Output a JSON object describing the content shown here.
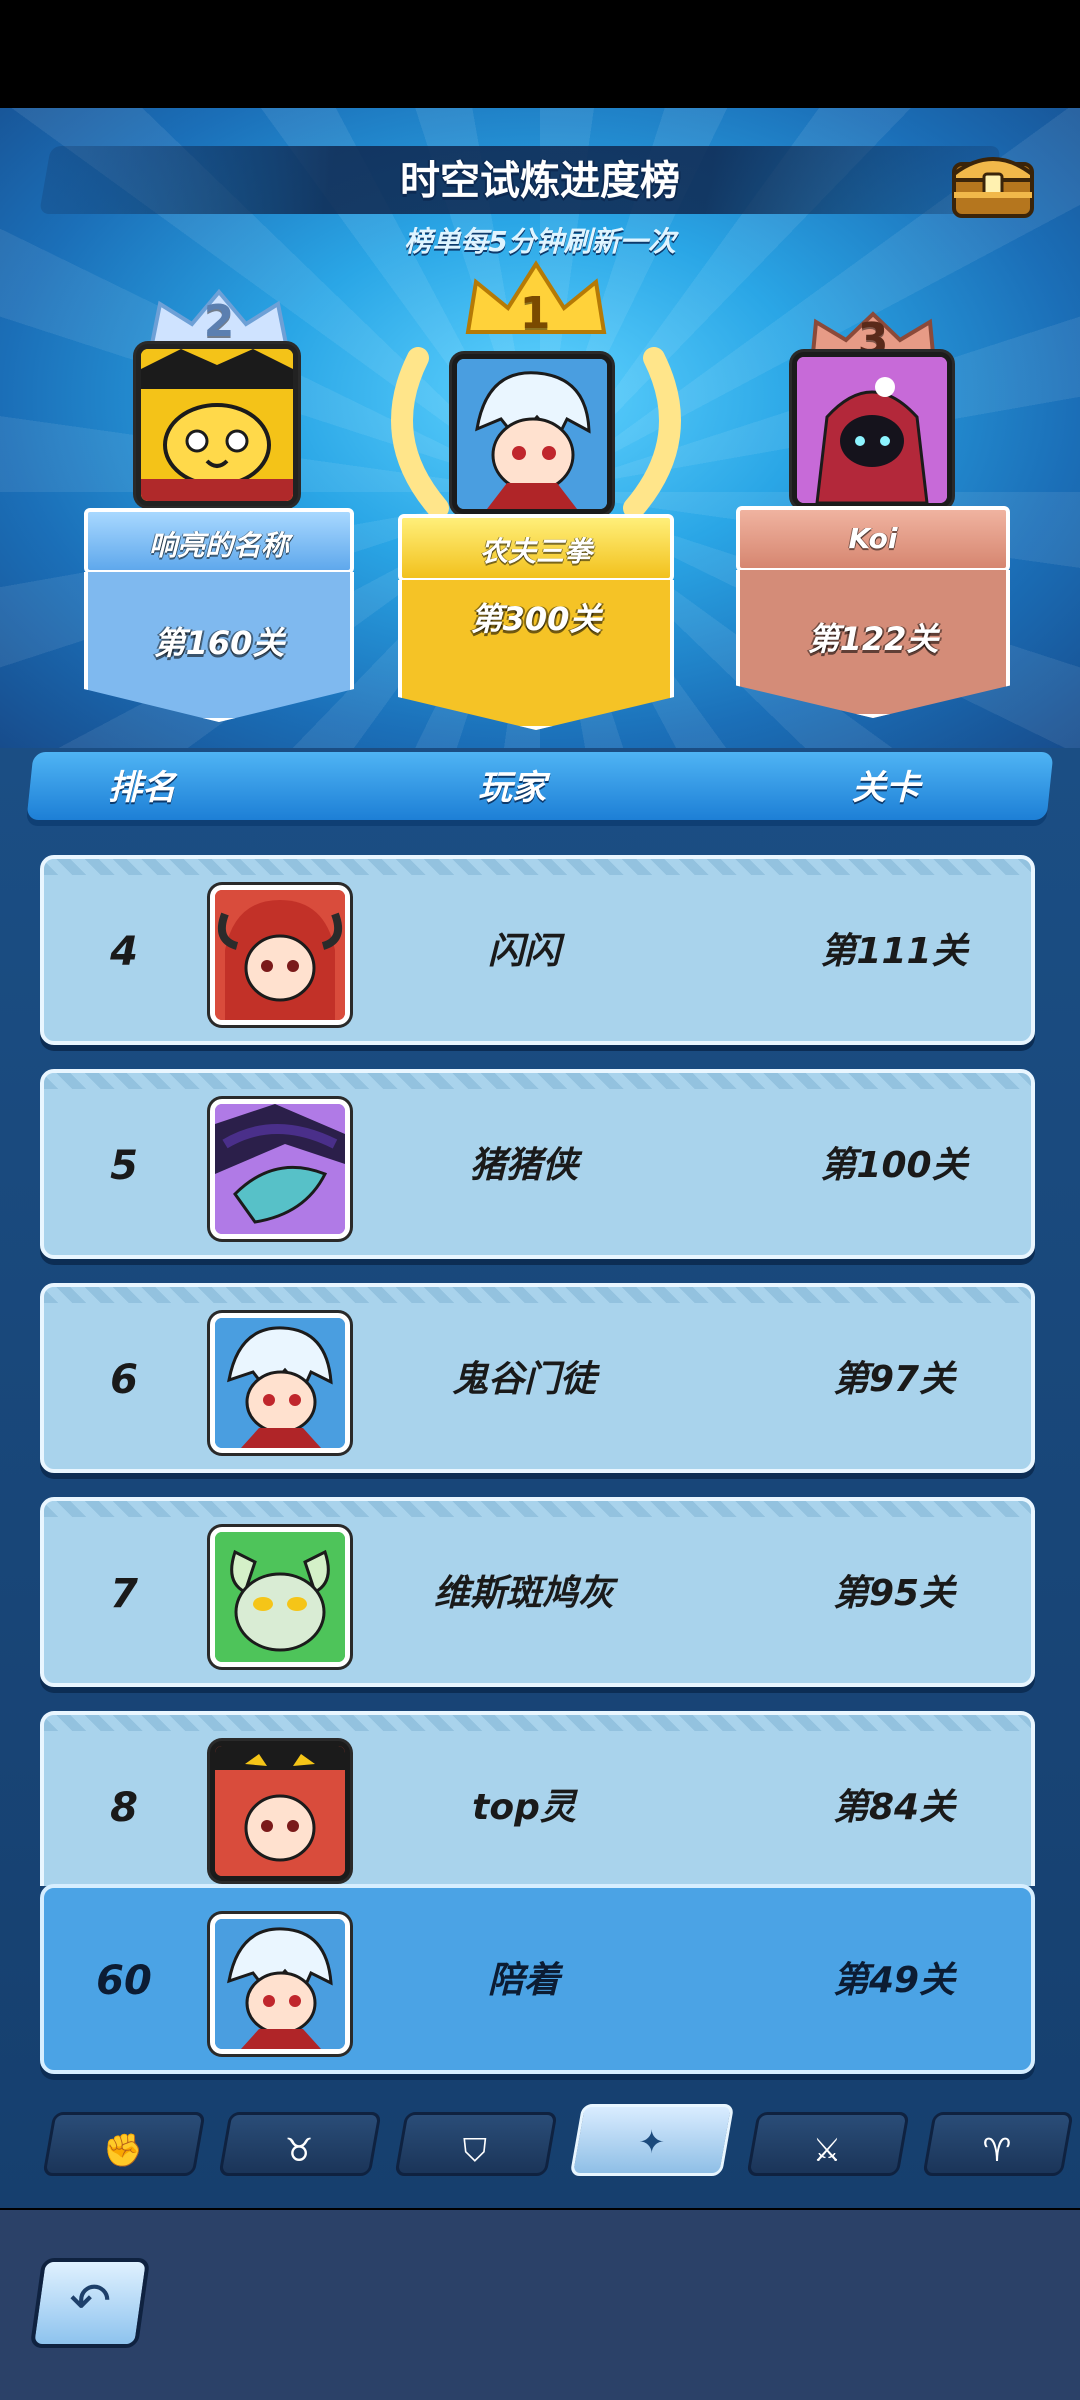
{
  "header": {
    "title": "时空试炼进度榜",
    "subtitle": "榜单每5分钟刷新一次"
  },
  "podium": [
    {
      "rank": "2",
      "name": "响亮的名称",
      "level": "第160关"
    },
    {
      "rank": "1",
      "name": "农夫三拳",
      "level": "第300关"
    },
    {
      "rank": "3",
      "name": "Koi",
      "level": "第122关"
    }
  ],
  "table": {
    "columns": [
      "排名",
      "玩家",
      "关卡"
    ],
    "rows": [
      {
        "rank": "4",
        "name": "闪闪",
        "level": "第111关"
      },
      {
        "rank": "5",
        "name": "猪猪侠",
        "level": "第100关"
      },
      {
        "rank": "6",
        "name": "鬼谷门徒",
        "level": "第97关"
      },
      {
        "rank": "7",
        "name": "维斯斑鸠灰",
        "level": "第95关"
      },
      {
        "rank": "8",
        "name": "top灵",
        "level": "第84关"
      }
    ],
    "my_row": {
      "rank": "60",
      "name": "陪着",
      "level": "第49关"
    }
  },
  "tabs": [
    {
      "icon": "fist-icon"
    },
    {
      "icon": "bull-icon"
    },
    {
      "icon": "shield-icon"
    },
    {
      "icon": "portal-icon",
      "active": true
    },
    {
      "icon": "sword-icon"
    },
    {
      "icon": "horned-helmet-icon"
    }
  ],
  "colors": {
    "gold": "#f6c62a",
    "silver": "#8ec3f0",
    "bronze": "#d88d78",
    "row_bg": "#a9d3ec",
    "my_row_bg": "#4ba3e5"
  }
}
